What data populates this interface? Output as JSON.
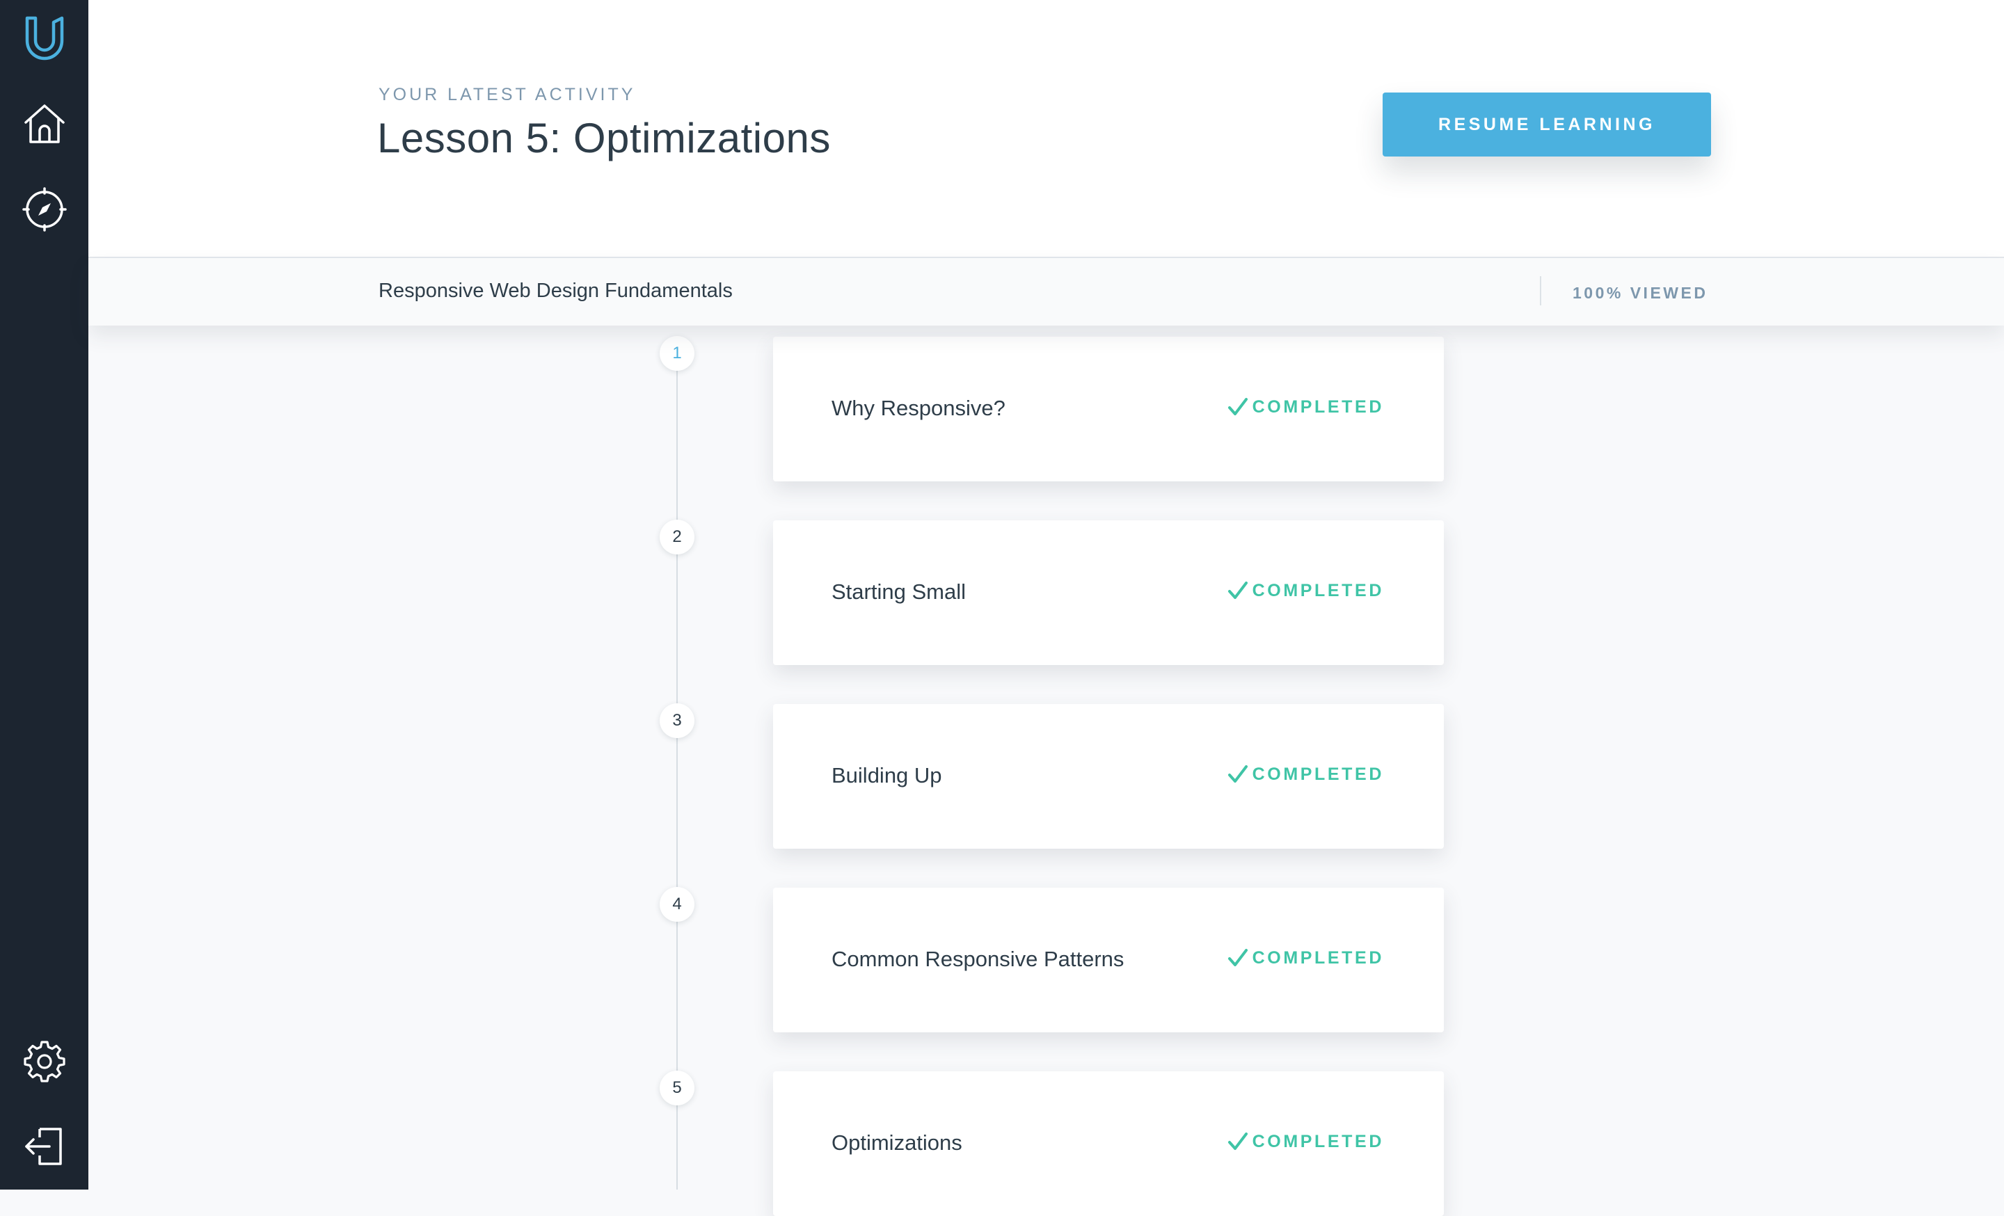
{
  "sidebar": {
    "logo_icon": "udacity-logo-icon",
    "items": [
      {
        "name": "home",
        "icon": "home-icon"
      },
      {
        "name": "catalog",
        "icon": "compass-icon"
      }
    ],
    "bottom_items": [
      {
        "name": "settings",
        "icon": "gear-icon"
      },
      {
        "name": "logout",
        "icon": "logout-icon"
      }
    ]
  },
  "header": {
    "eyebrow": "YOUR LATEST ACTIVITY",
    "lesson_title": "Lesson 5: Optimizations",
    "resume_label": "RESUME LEARNING"
  },
  "course_bar": {
    "course_name": "Responsive Web Design Fundamentals",
    "progress_label": "100% VIEWED",
    "progress_percent": 100
  },
  "lessons": [
    {
      "number": "1",
      "title": "Why Responsive?",
      "status": "COMPLETED",
      "active": true
    },
    {
      "number": "2",
      "title": "Starting Small",
      "status": "COMPLETED",
      "active": false
    },
    {
      "number": "3",
      "title": "Building Up",
      "status": "COMPLETED",
      "active": false
    },
    {
      "number": "4",
      "title": "Common Responsive Patterns",
      "status": "COMPLETED",
      "active": false
    },
    {
      "number": "5",
      "title": "Optimizations",
      "status": "COMPLETED",
      "active": false
    }
  ],
  "colors": {
    "sidebar_bg": "#1c2530",
    "accent_blue": "#4bb1df",
    "completed_green": "#3fc4a6",
    "text_dark": "#2e3d49",
    "text_muted": "#7d97ad"
  }
}
